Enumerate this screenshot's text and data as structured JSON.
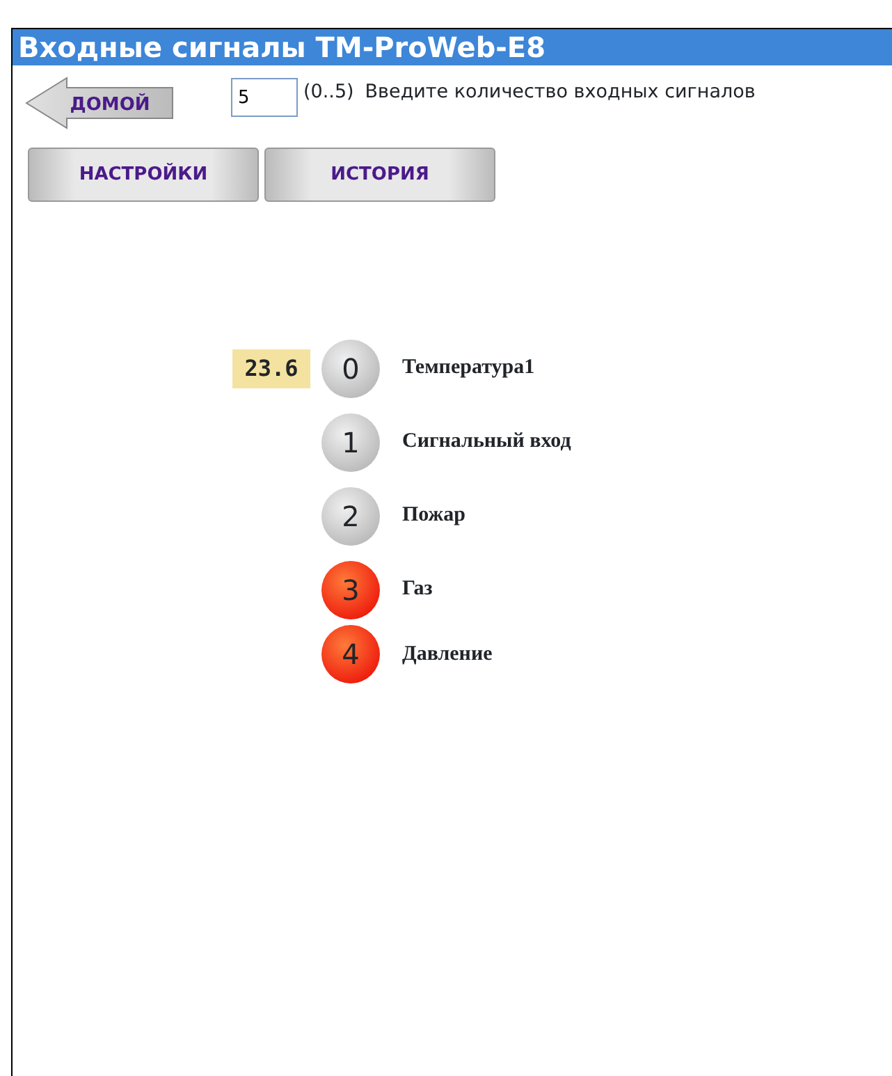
{
  "header": {
    "title": "Входные сигналы TM-ProWeb-E8"
  },
  "home_button": {
    "label": "ДОМОЙ"
  },
  "count_field": {
    "value": "5",
    "range": "(0..5)",
    "label": "Введите количество входных сигналов"
  },
  "buttons": [
    "НАСТРОЙКИ",
    "ИСТОРИЯ"
  ],
  "signals": [
    {
      "number": "0",
      "name": "Температура1",
      "value": "23.6",
      "alarm": false
    },
    {
      "number": "1",
      "name": "Сигнальный вход",
      "alarm": false
    },
    {
      "number": "2",
      "name": "Пожар",
      "alarm": false
    },
    {
      "number": "3",
      "name": "Газ",
      "alarm": true
    },
    {
      "number": "4",
      "name": "Давление",
      "alarm": true
    }
  ]
}
